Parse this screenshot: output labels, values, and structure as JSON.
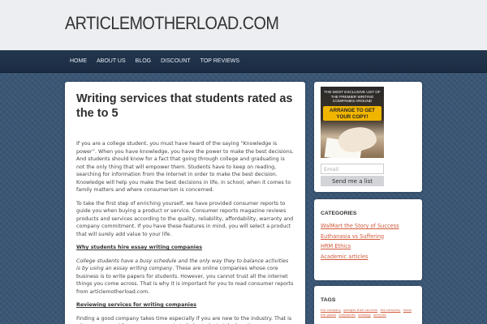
{
  "header": {
    "site_title": "ARTICLEMOTHERLOAD.COM"
  },
  "nav": {
    "items": [
      "HOME",
      "ABOUT US",
      "BLOG",
      "DISCOUNT",
      "TOP REVIEWS"
    ]
  },
  "post": {
    "title": "Writing services that students rated as the to 5",
    "paragraphs": [
      "If you are a college student, you must have heard of the saying “Knowledge is power”. When you have knowledge, you have the power to make the best decisions. And students should know for a fact that going through college and graduating is not the only thing that will empower them. Students have to keep on reading, searching for information from the Internet in order to make the best decision. Knowledge will help you make the best decisions in life, in school, when it comes to family matters and where consumerism is concerned.",
      "To take the first step of enriching yourself, we have provided consumer reports to guide you when buying a product or service. Consumer reports magazine reviews products and services according to the quality, reliability, affordability, warranty and company commitment. If you have these features in mind, you will select a product that will surely add value to your life."
    ],
    "subhead_1": "Why students hire essay writing companies",
    "para_3_italic": "College students have a busy schedule and the only way they to balance activities is by using an essay writing company",
    "para_3_rest": ". These are online companies whose core business is to write papers for students. However, you cannot trust all the internet things you come across. That is why it is important for you to read consumer reports from articlemotherload.com.",
    "subhead_2": "Reviewing services for writing companies",
    "para_4": "Finding a good company takes time especially if you are new to the industry. That is why we are providing consumer reports to help students take less time on"
  },
  "sidebar": {
    "ad": {
      "headline": "THE MOST EXCLUSIVE LIST OF THE PREMIER WRITING COMPANIES AROUND",
      "cta": "ARRANGE TO GET YOUR COPY!",
      "email_placeholder": "Email",
      "send_label": "Send me a list"
    },
    "categories": {
      "heading": "CATEGORIES",
      "items": [
        "WalMart the Story of Success",
        "Euthanasia vs Suffering",
        "HRM Ethics",
        "Academic articles"
      ]
    },
    "tags": {
      "heading": "TAGS",
      "items": [
        "the company",
        "garages their services",
        "the company",
        "leads",
        "the global",
        "companies",
        "strategy",
        "services"
      ]
    }
  },
  "colors": {
    "link": "#d05a3a",
    "cta": "#f0b500",
    "nav_bg": "#23364e"
  }
}
